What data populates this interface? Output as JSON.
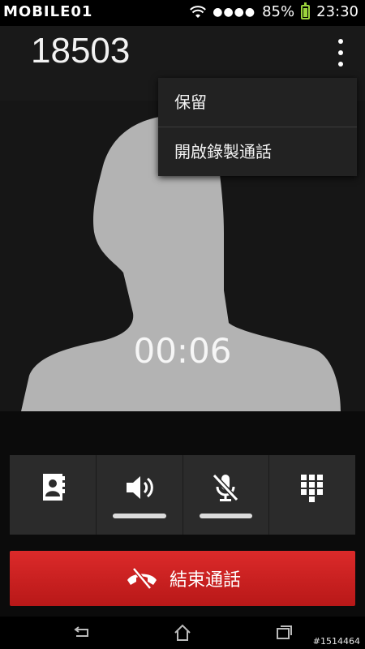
{
  "status_bar": {
    "brand": "MOBILE01",
    "battery_text": "85%",
    "time": "23:30",
    "icons": [
      "wifi-icon",
      "signal-icon",
      "battery-icon"
    ]
  },
  "call": {
    "number": "18503",
    "timer": "00:06"
  },
  "menu": {
    "items": [
      {
        "label": "保留"
      },
      {
        "label": "開啟錄製通話"
      }
    ]
  },
  "controls": {
    "items": [
      {
        "name": "contacts",
        "icon": "contacts-icon"
      },
      {
        "name": "speaker",
        "icon": "speaker-icon"
      },
      {
        "name": "mute",
        "icon": "mic-off-icon"
      },
      {
        "name": "dialpad",
        "icon": "dialpad-icon"
      }
    ]
  },
  "end_call": {
    "label": "結束通話",
    "icon": "end-call-icon",
    "color": "#d32222"
  },
  "nav": {
    "icons": [
      "back-icon",
      "home-icon",
      "recent-apps-icon"
    ]
  },
  "watermark": "#1514464"
}
